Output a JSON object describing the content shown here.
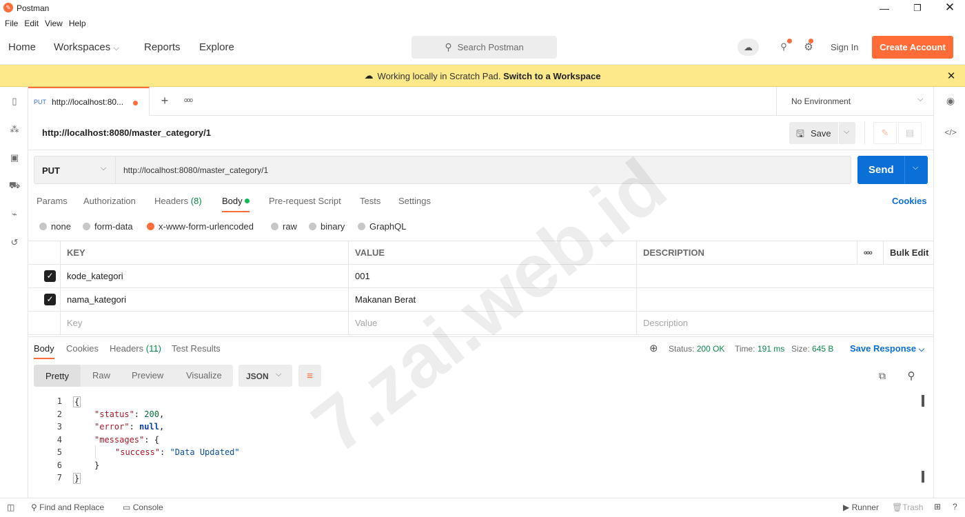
{
  "window": {
    "title": "Postman"
  },
  "menu": [
    "File",
    "Edit",
    "View",
    "Help"
  ],
  "nav": {
    "home": "Home",
    "workspaces": "Workspaces",
    "reports": "Reports",
    "explore": "Explore",
    "search_placeholder": "Search Postman",
    "sign_in": "Sign In",
    "create_account": "Create Account"
  },
  "banner": {
    "text": "Working locally in Scratch Pad.",
    "link": "Switch to a Workspace"
  },
  "tab": {
    "method": "PUT",
    "title": "http://localhost:80...",
    "more": "ooo"
  },
  "environment": "No Environment",
  "request": {
    "name": "http://localhost:8080/master_category/1",
    "save": "Save",
    "method": "PUT",
    "url": "http://localhost:8080/master_category/1",
    "send": "Send"
  },
  "req_tabs": {
    "params": "Params",
    "authorization": "Authorization",
    "headers": "Headers",
    "headers_count": "(8)",
    "body": "Body",
    "prerequest": "Pre-request Script",
    "tests": "Tests",
    "settings": "Settings",
    "cookies": "Cookies"
  },
  "body_types": [
    "none",
    "form-data",
    "x-www-form-urlencoded",
    "raw",
    "binary",
    "GraphQL"
  ],
  "table": {
    "headers": {
      "key": "KEY",
      "value": "VALUE",
      "description": "DESCRIPTION",
      "more": "ooo",
      "bulk_edit": "Bulk Edit"
    },
    "rows": [
      {
        "key": "kode_kategori",
        "value": "001",
        "description": ""
      },
      {
        "key": "nama_kategori",
        "value": "Makanan Berat",
        "description": ""
      }
    ],
    "placeholder": {
      "key": "Key",
      "value": "Value",
      "description": "Description"
    }
  },
  "response": {
    "tabs": {
      "body": "Body",
      "cookies": "Cookies",
      "headers": "Headers",
      "headers_count": "(11)",
      "test_results": "Test Results"
    },
    "status_label": "Status:",
    "status_value": "200 OK",
    "time_label": "Time:",
    "time_value": "191 ms",
    "size_label": "Size:",
    "size_value": "645 B",
    "save_response": "Save Response",
    "views": {
      "pretty": "Pretty",
      "raw": "Raw",
      "preview": "Preview",
      "visualize": "Visualize"
    },
    "format": "JSON",
    "lines": [
      "1",
      "2",
      "3",
      "4",
      "5",
      "6",
      "7"
    ],
    "code": {
      "l1": "{",
      "k_status": "\"status\"",
      "v_status": "200",
      "k_error": "\"error\"",
      "v_error": "null",
      "k_messages": "\"messages\"",
      "v_messages_open": "{",
      "k_success": "\"success\"",
      "v_success": "\"Data Updated\"",
      "l6": "}",
      "l7": "}"
    }
  },
  "statusbar": {
    "find_replace": "Find and Replace",
    "console": "Console",
    "runner": "Runner",
    "trash": "Trash"
  },
  "watermark": "7.zai.web.id",
  "colors": {
    "accent": "#ff6c37",
    "send_blue": "#0b6fd8",
    "link_blue": "#0b6fd8",
    "banner": "#fde98a",
    "status_green": "#0a8a48"
  }
}
